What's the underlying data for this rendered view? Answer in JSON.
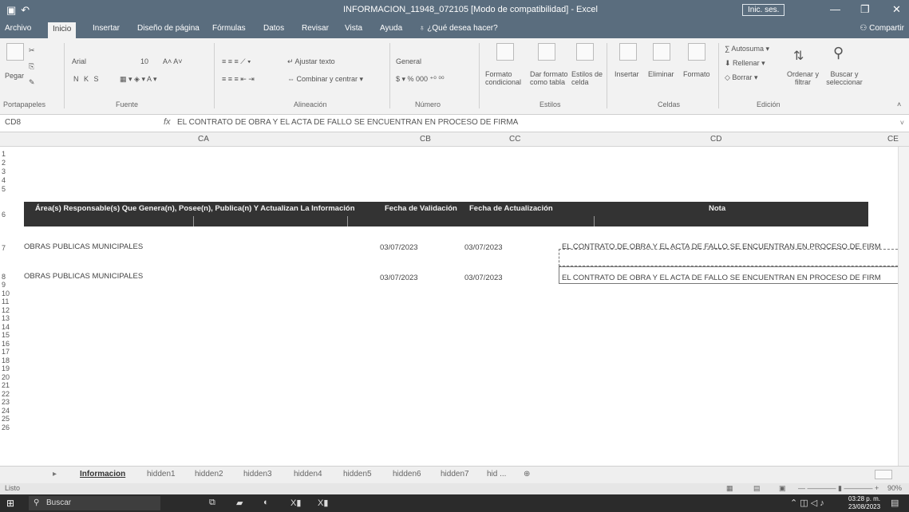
{
  "titlebar": {
    "document_title": "INFORMACION_11948_072105 [Modo de compatibilidad] - Excel",
    "signin_label": "Inic. ses.",
    "minimize": "—",
    "restore": "❐",
    "close": "✕"
  },
  "menu": {
    "tabs": [
      "Archivo",
      "Inicio",
      "Insertar",
      "Diseño de página",
      "Fórmulas",
      "Datos",
      "Revisar",
      "Vista",
      "Ayuda"
    ],
    "tell_me": "¿Qué desea hacer?",
    "share": "Compartir"
  },
  "ribbon": {
    "paste": "Pegar",
    "font_name": "Arial",
    "font_size": "10",
    "bold_italic": "N K S",
    "wrap_text": "Ajustar texto",
    "merge_center": "Combinar y centrar",
    "number_format": "General",
    "conditional_format": "Formato condicional",
    "format_as_table": "Dar formato como tabla",
    "cell_styles": "Estilos de celda",
    "insert": "Insertar",
    "delete": "Eliminar",
    "format": "Formato",
    "autosum": "Autosuma",
    "fill": "Rellenar",
    "clear": "Borrar",
    "sort_filter": "Ordenar y filtrar",
    "find_select": "Buscar y seleccionar",
    "groups": [
      "Portapapeles",
      "Fuente",
      "Alineación",
      "Número",
      "Estilos",
      "Celdas",
      "Edición"
    ]
  },
  "formula_bar": {
    "name_box": "CD8",
    "fx": "fx",
    "content": "EL CONTRATO DE OBRA Y EL ACTA DE FALLO SE ENCUENTRAN EN PROCESO DE FIRMA"
  },
  "columns": [
    "CA",
    "CB",
    "CC",
    "CD",
    "CE"
  ],
  "row_numbers": [
    "1",
    "2",
    "3",
    "4",
    "5",
    "6",
    "7",
    "8",
    "9",
    "10",
    "11",
    "12",
    "13",
    "14",
    "15",
    "16",
    "17",
    "18",
    "19",
    "20",
    "21",
    "22",
    "23",
    "24",
    "25",
    "26"
  ],
  "table": {
    "headers": {
      "area": "Área(s) Responsable(s) Que Genera(n), Posee(n), Publica(n) Y Actualizan La Información",
      "validation": "Fecha de Validación",
      "update": "Fecha de Actualización",
      "note": "Nota"
    },
    "rows": [
      {
        "area": "OBRAS PUBLICAS MUNICIPALES",
        "validation": "03/07/2023",
        "update": "03/07/2023",
        "note": "EL CONTRATO DE OBRA Y EL ACTA DE FALLO SE ENCUENTRAN EN PROCESO DE FIRM"
      },
      {
        "area": "OBRAS PUBLICAS MUNICIPALES",
        "validation": "03/07/2023",
        "update": "03/07/2023",
        "note": "EL CONTRATO DE OBRA Y EL ACTA DE FALLO SE ENCUENTRAN EN PROCESO DE FIRM"
      }
    ]
  },
  "sheet_tabs": [
    "Informacion",
    "hidden1",
    "hidden2",
    "hidden3",
    "hidden4",
    "hidden5",
    "hidden6",
    "hidden7",
    "hid ..."
  ],
  "status": {
    "mode": "Listo",
    "zoom": "90%"
  },
  "taskbar": {
    "search_placeholder": "Buscar",
    "time": "03:28 p. m.",
    "date": "23/08/2023"
  },
  "colors": {
    "titlebar": "#5a6d7e",
    "header_band": "#333333"
  }
}
